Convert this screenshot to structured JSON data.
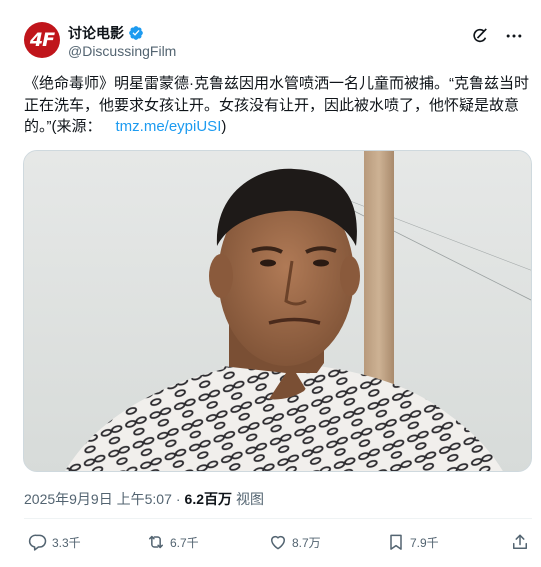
{
  "author": {
    "display_name": "讨论电影",
    "handle": "@DiscussingFilm",
    "avatar_mark": "4F",
    "verified": true
  },
  "tweet": {
    "text_main": "《绝命毒师》明星雷蒙德·克鲁兹因用水管喷洒一名儿童而被捕。“克鲁兹当时正在洗车，他要求女孩让开。女孩没有让开，因此被水喷了，他怀疑是故意的。”(来源：",
    "link": "tmz.me/eypiUSI",
    "text_end": ")"
  },
  "meta": {
    "timestamp": "2025年9月9日 上午5:07",
    "separator": "·",
    "views_count": "6.2百万",
    "views_label": "视图"
  },
  "actions": {
    "replies": "3.3千",
    "retweets": "6.7千",
    "likes": "8.7万",
    "bookmarks": "7.9千"
  },
  "colors": {
    "accent": "#1d9bf0",
    "avatar_bg": "#c0151b",
    "muted": "#536471"
  },
  "icons": [
    "grok-icon",
    "more-icon",
    "reply-icon",
    "retweet-icon",
    "like-icon",
    "bookmark-icon",
    "share-icon",
    "verified-badge-icon"
  ]
}
